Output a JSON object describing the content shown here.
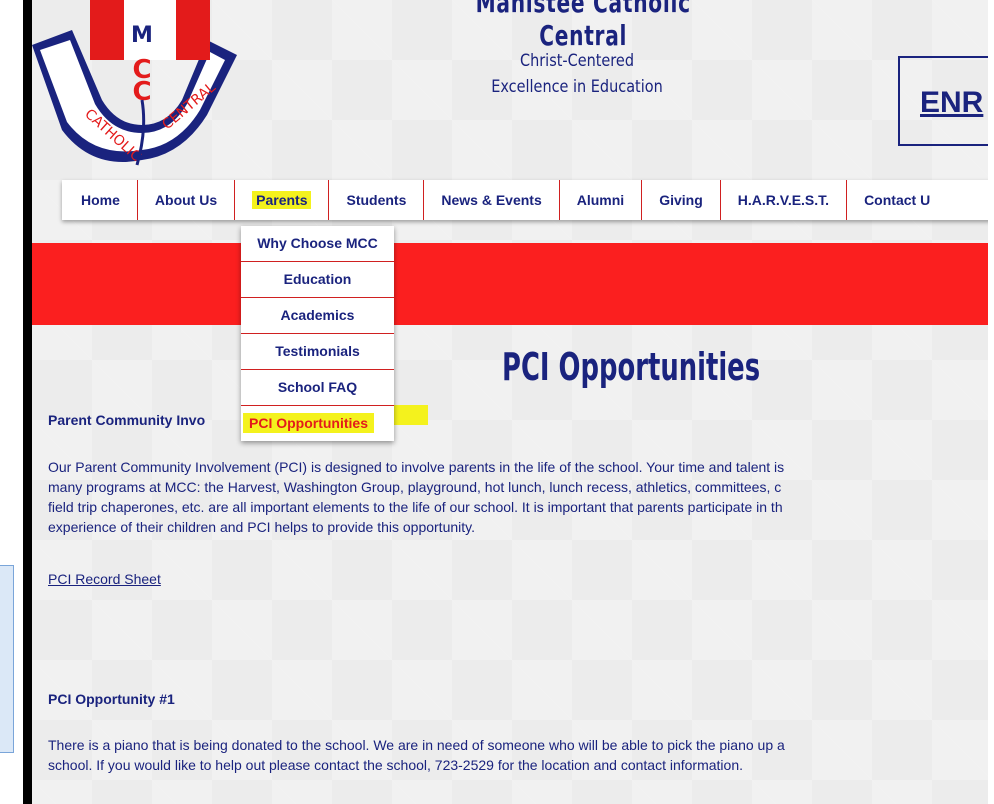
{
  "header": {
    "site_name": "Manistee Catholic Central",
    "tagline_line1": "Christ-Centered",
    "tagline_line2": "Excellence in Education",
    "enroll_label": "ENR"
  },
  "logo": {
    "letters": "MCC",
    "ribbon_left": "CATHOLIC",
    "ribbon_right": "CENTRAL"
  },
  "nav": {
    "items": [
      {
        "label": "Home"
      },
      {
        "label": "About Us"
      },
      {
        "label": "Parents"
      },
      {
        "label": "Students"
      },
      {
        "label": "News & Events"
      },
      {
        "label": "Alumni"
      },
      {
        "label": "Giving"
      },
      {
        "label": "H.A.R.V.E.S.T."
      },
      {
        "label": "Contact U"
      }
    ]
  },
  "dropdown": {
    "items": [
      {
        "label": "Why Choose MCC"
      },
      {
        "label": "Education"
      },
      {
        "label": "Academics"
      },
      {
        "label": "Testimonials"
      },
      {
        "label": "School FAQ"
      },
      {
        "label": "PCI Opportunities"
      }
    ]
  },
  "main": {
    "page_title": "PCI Opportunities",
    "section_heading": "Parent Community Invo",
    "paragraph_lines": [
      "Our Parent Community Involvement (PCI) is designed to involve parents in the life of the school. Your time and talent is",
      "many programs at MCC: the Harvest, Washington Group, playground, hot lunch, lunch recess, athletics, committees, c",
      "field trip chaperones, etc. are all important elements to the life of our school. It is important that parents participate in th",
      "experience of their children and PCI helps to provide this opportunity."
    ],
    "record_sheet_link": "PCI Record Sheet",
    "opportunity_heading": "PCI Opportunity #1",
    "opportunity_lines": [
      "There is a piano that is being donated to the school. We are in need of someone who will be able to pick the piano up a",
      "school. If you would like to help out please contact the school, 723-2529 for the location and contact information."
    ]
  },
  "colors": {
    "brand_navy": "#1a237e",
    "brand_red": "#fb1f1f",
    "highlight_yellow": "#f4f21d"
  }
}
